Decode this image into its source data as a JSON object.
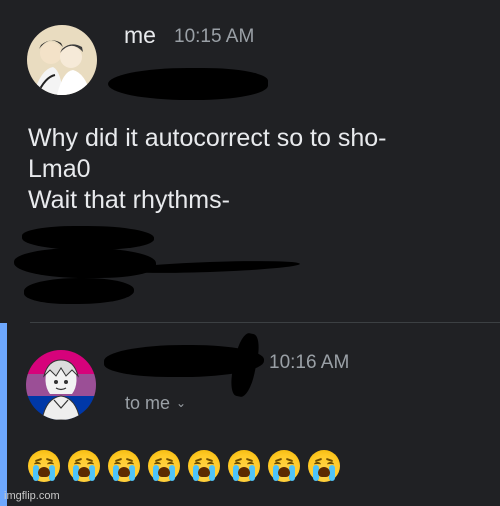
{
  "message1": {
    "sender": "me",
    "time": "10:15 AM",
    "lines": [
      "Why did it autocorrect so to sho-",
      "Lma0",
      "Wait that rhythms-"
    ]
  },
  "message2": {
    "time": "10:16 AM",
    "to": "to me",
    "chevron": "⌄",
    "emoji_name": "loudly-crying-face",
    "emoji_count": 8
  },
  "watermark": "imgflip.com",
  "colors": {
    "background": "#202124",
    "text": "#e8eaed",
    "muted": "#9aa0a6",
    "accent": "#6ea8fe",
    "redaction": "#000000"
  }
}
